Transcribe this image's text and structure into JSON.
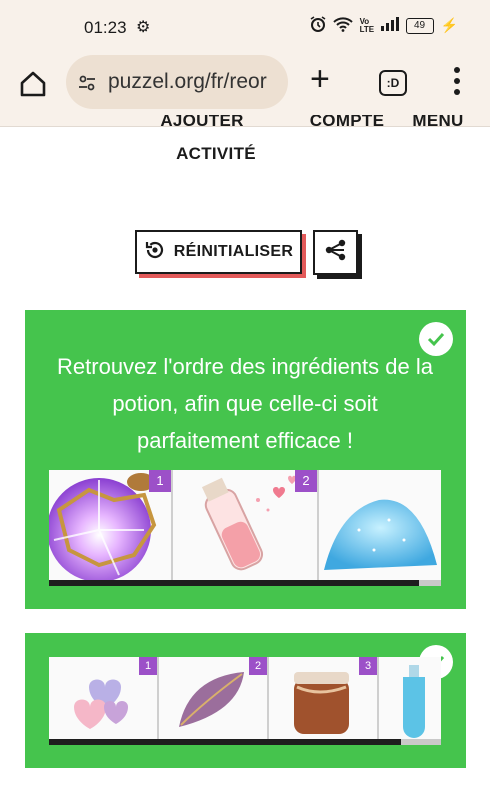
{
  "status_bar": {
    "time": "01:23",
    "battery": "49",
    "network": "Vo LTE"
  },
  "browser": {
    "url": "puzzel.org/fr/reor",
    "tabs_label": ":D"
  },
  "nav": {
    "add_activity_line1": "AJOUTER UNE",
    "add_activity_line2": "ACTIVITÉ",
    "account": "COMPTE",
    "menu": "MENU"
  },
  "toolbar": {
    "reset_label": "RÉINITIALISER"
  },
  "cards": [
    {
      "title": "Retrouvez l'ordre des ingrédients de la potion, afin que celle-ci soit parfaitement efficace !",
      "tiles": [
        {
          "number": "1",
          "image": "purple-crystal-orb-image"
        },
        {
          "number": "2",
          "image": "pink-love-potion-bottle-image"
        },
        {
          "number": "",
          "image": "blue-sparkle-sand-image"
        }
      ]
    },
    {
      "tiles": [
        {
          "number": "1",
          "image": "candy-hearts-image"
        },
        {
          "number": "2",
          "image": "purple-bean-pod-image"
        },
        {
          "number": "3",
          "image": "honey-jar-image"
        },
        {
          "number": "",
          "image": "blue-potion-bottle-image"
        }
      ]
    }
  ],
  "colors": {
    "card_green": "#45c44d",
    "badge_purple": "#9c50c8",
    "status_bg": "#f8f1ea",
    "reset_shadow": "#e35a5a"
  }
}
